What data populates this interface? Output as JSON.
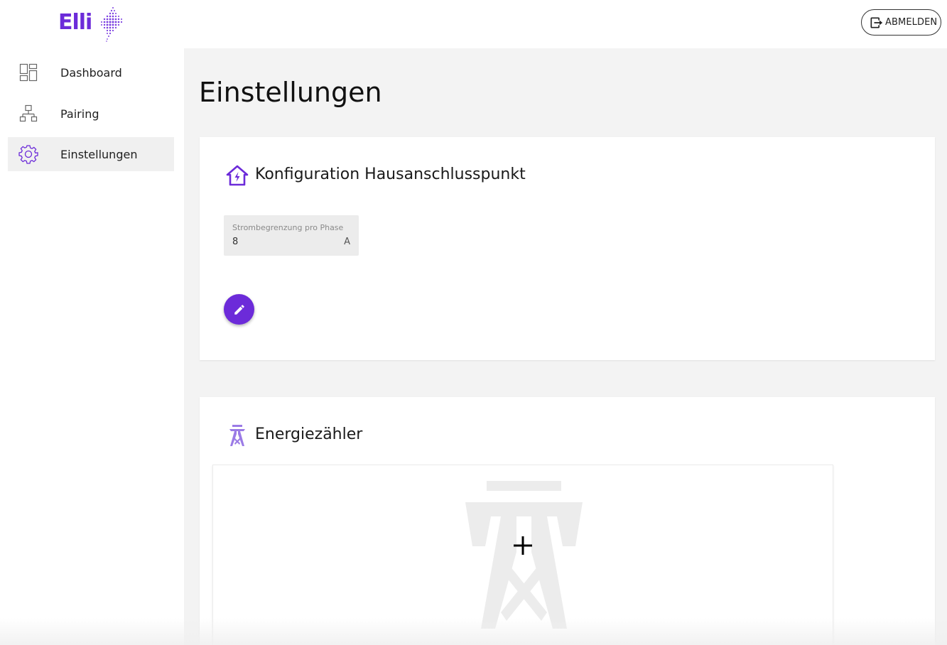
{
  "brand": {
    "name": "Elli",
    "color": "#6c2bd9"
  },
  "header": {
    "logout_label": "ABMELDEN"
  },
  "sidebar": {
    "items": [
      {
        "label": "Dashboard",
        "icon": "dashboard-icon"
      },
      {
        "label": "Pairing",
        "icon": "pairing-icon"
      },
      {
        "label": "Einstellungen",
        "icon": "gear-icon",
        "active": true
      }
    ]
  },
  "main": {
    "title": "Einstellungen",
    "house_connection": {
      "title": "Konfiguration Hausanschlusspunkt",
      "icon": "house-lightning-icon",
      "current_limit": {
        "label": "Strombegrenzung pro Phase",
        "value": "8",
        "unit": "A"
      },
      "edit_icon": "pencil-icon"
    },
    "energy_meter": {
      "title": "Energiezähler",
      "icon": "power-pylon-icon",
      "add_icon": "plus-icon"
    }
  }
}
